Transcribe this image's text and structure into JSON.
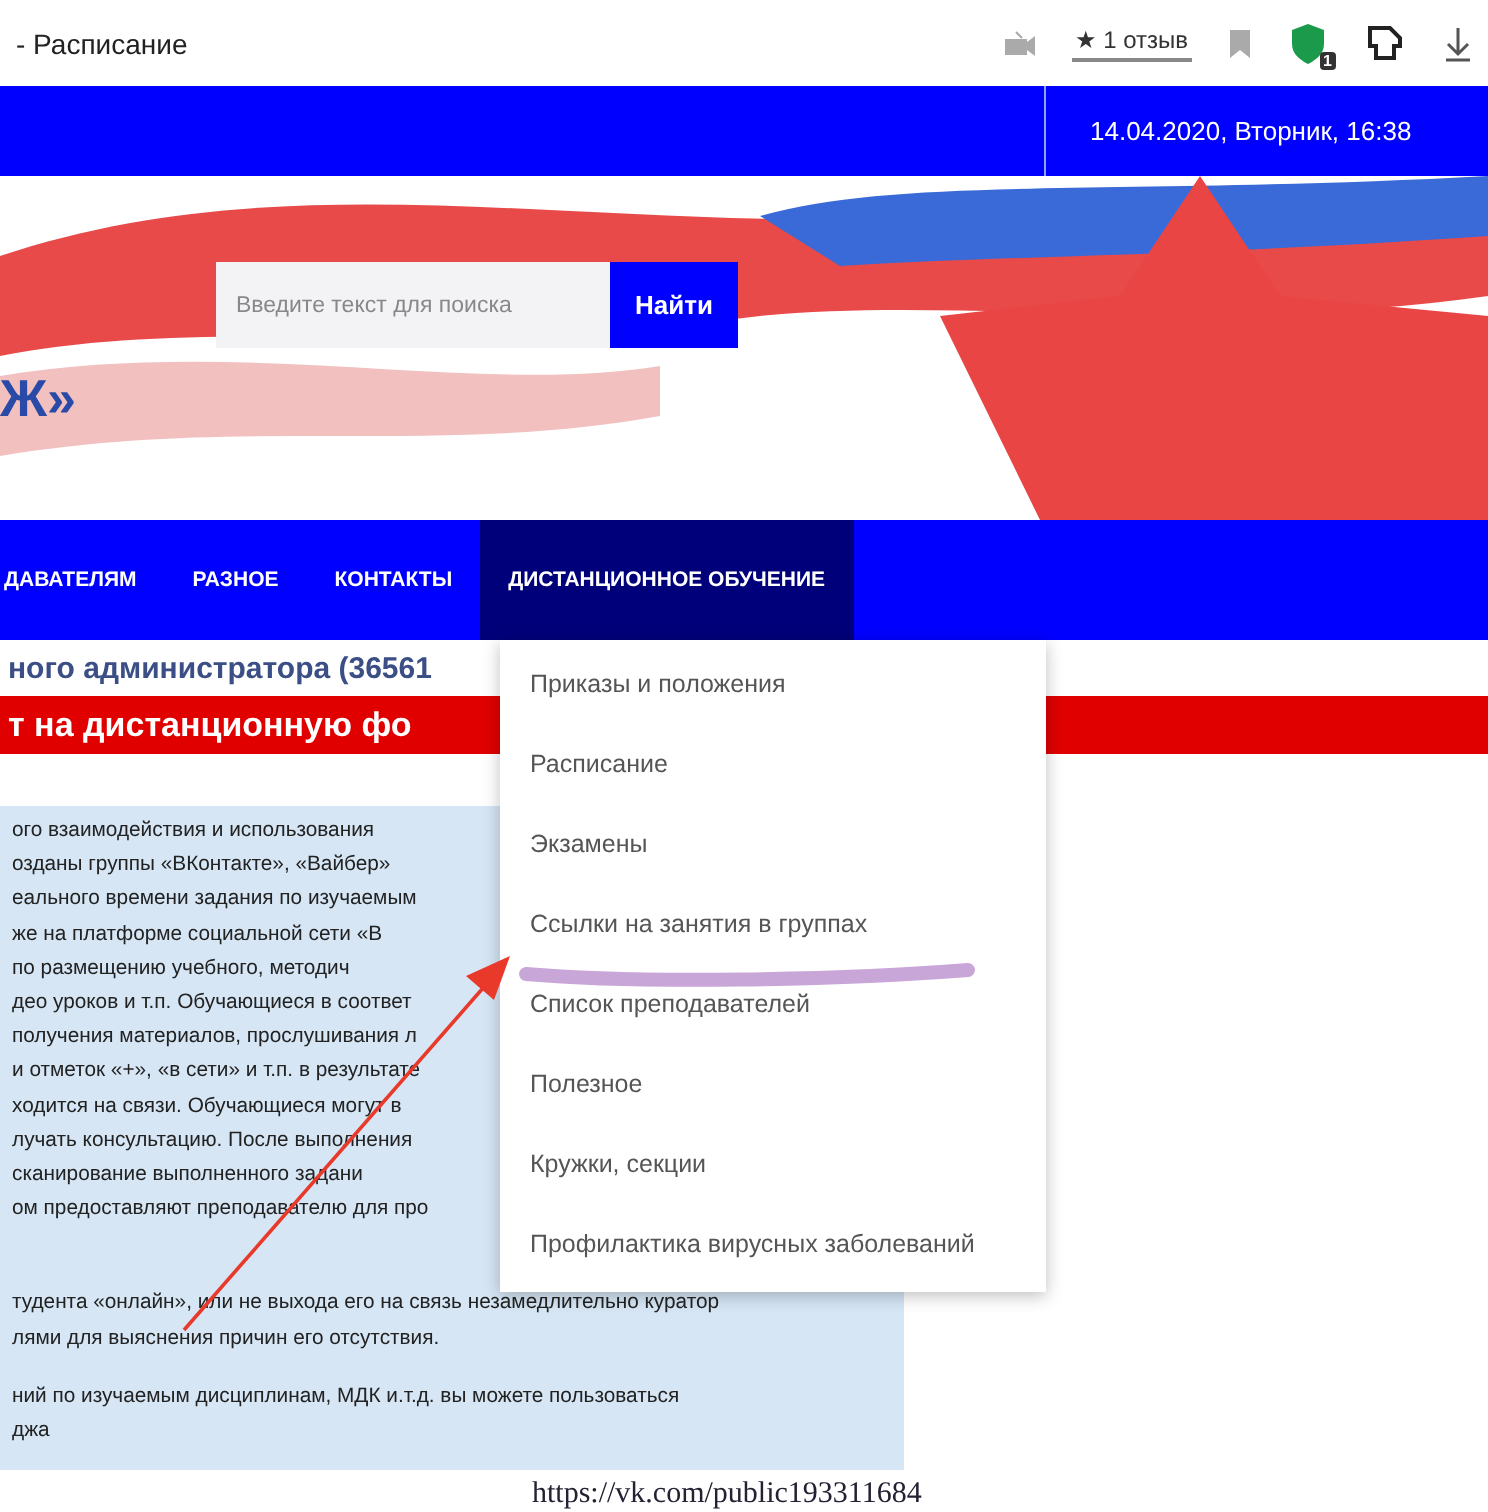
{
  "browser_bar": {
    "title": "- Расписание",
    "review_star": "★",
    "review": "1 отзыв",
    "shield_badge": "1"
  },
  "header": {
    "datetime": "14.04.2020, Вторник, 16:38"
  },
  "hero": {
    "logo_fragment": "Ж»",
    "search": {
      "placeholder": "Введите текст для поиска",
      "button": "Найти"
    }
  },
  "nav": [
    {
      "label": "ДАВАТЕЛЯМ",
      "selected": false
    },
    {
      "label": "РАЗНОЕ",
      "selected": false
    },
    {
      "label": "КОНТАКТЫ",
      "selected": false
    },
    {
      "label": "ДИСТАНЦИОННОЕ ОБУЧЕНИЕ",
      "selected": true
    }
  ],
  "dropdown": [
    "Приказы и положения",
    "Расписание",
    "Экзамены",
    "Ссылки на занятия в группах",
    "Список преподавателей",
    "Полезное",
    "Кружки, секции",
    "Профилактика вирусных заболеваний"
  ],
  "subheading": "ного администратора (36561",
  "banner": "т на дистанционную фо",
  "notice": [
    [
      "ого взаимодействия и использования",
      "озданы группы «ВКонтакте», «Вайбер»",
      "еального времени задания по изучаемым",
      "же на платформе социальной сети «В",
      "по размещению учебного, методич",
      "део уроков и т.п. Обучающиеся в соответ",
      "получения материалов, прослушивания л",
      "и отметок «+», «в сети» и т.п. в результате",
      "ходится на связи. Обучающиеся могут в",
      "лучать консультацию. После выполнения",
      "сканирование выполненного задани",
      "ом предоставляют преподавателю для про"
    ],
    [
      "тудента «онлайн», или не выхода его на связь незамедлительно куратор",
      "лями для выяснения причин его отсутствия."
    ],
    [
      "ний по изучаемым дисциплинам, МДК и.т.д. вы можете пользоваться",
      "джа"
    ]
  ],
  "link": "https://vk.com/public193311684"
}
